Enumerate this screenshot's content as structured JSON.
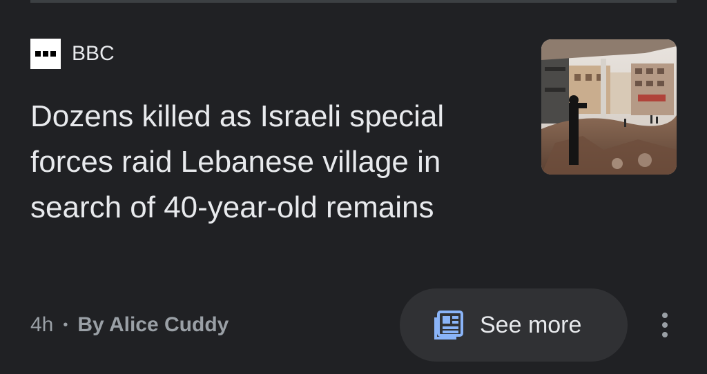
{
  "source": {
    "name": "BBC",
    "logo_icon": "bbc-logo-icon"
  },
  "headline": "Dozens killed as Israeli special forces raid Lebanese village in search of 40-year-old remains",
  "thumbnail": {
    "icon": "news-photo-thumbnail"
  },
  "meta": {
    "time": "4h",
    "separator": "•",
    "author": "By Alice Cuddy"
  },
  "actions": {
    "see_more_label": "See more",
    "see_more_icon": "newspaper-icon",
    "menu_icon": "more-vert-icon"
  },
  "colors": {
    "background": "#202124",
    "text_primary": "#e8eaed",
    "text_secondary": "#9aa0a6",
    "chip_background": "#303134",
    "accent_blue": "#8ab4f8"
  }
}
